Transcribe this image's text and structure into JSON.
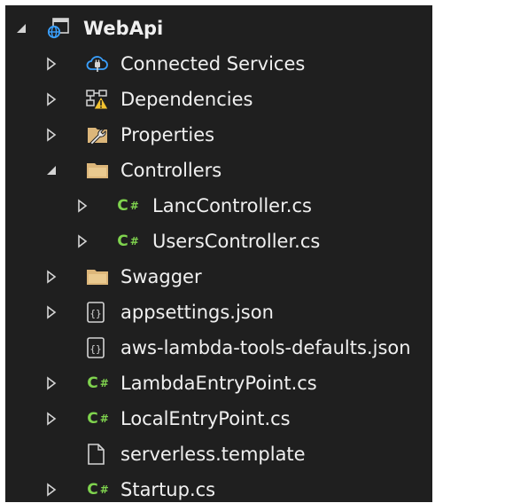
{
  "tree": {
    "project": {
      "label": "WebApi",
      "icon": "web-project-icon"
    },
    "items": [
      {
        "id": "connected-services",
        "label": "Connected Services",
        "icon": "connected-services-icon"
      },
      {
        "id": "dependencies",
        "label": "Dependencies",
        "icon": "dependencies-warning-icon"
      },
      {
        "id": "properties",
        "label": "Properties",
        "icon": "properties-wrench-icon"
      },
      {
        "id": "controllers",
        "label": "Controllers",
        "icon": "folder-icon"
      },
      {
        "id": "lanc-controller",
        "label": "LancController.cs",
        "icon": "csharp-file-icon"
      },
      {
        "id": "users-controller",
        "label": "UsersController.cs",
        "icon": "csharp-file-icon"
      },
      {
        "id": "swagger",
        "label": "Swagger",
        "icon": "folder-icon"
      },
      {
        "id": "appsettings",
        "label": "appsettings.json",
        "icon": "json-file-icon"
      },
      {
        "id": "aws-lambda-tools",
        "label": "aws-lambda-tools-defaults.json",
        "icon": "json-file-icon"
      },
      {
        "id": "lambda-entry",
        "label": "LambdaEntryPoint.cs",
        "icon": "csharp-file-icon"
      },
      {
        "id": "local-entry",
        "label": "LocalEntryPoint.cs",
        "icon": "csharp-file-icon"
      },
      {
        "id": "serverless-template",
        "label": "serverless.template",
        "icon": "file-icon"
      },
      {
        "id": "startup",
        "label": "Startup.cs",
        "icon": "csharp-file-icon"
      }
    ],
    "csharp_badge": "C#",
    "colors": {
      "background": "#1f1f1f",
      "text": "#f0f0f0",
      "csharp": "#7fd34e",
      "folder": "#dcb67a",
      "expander": "#d4d4d4"
    }
  }
}
